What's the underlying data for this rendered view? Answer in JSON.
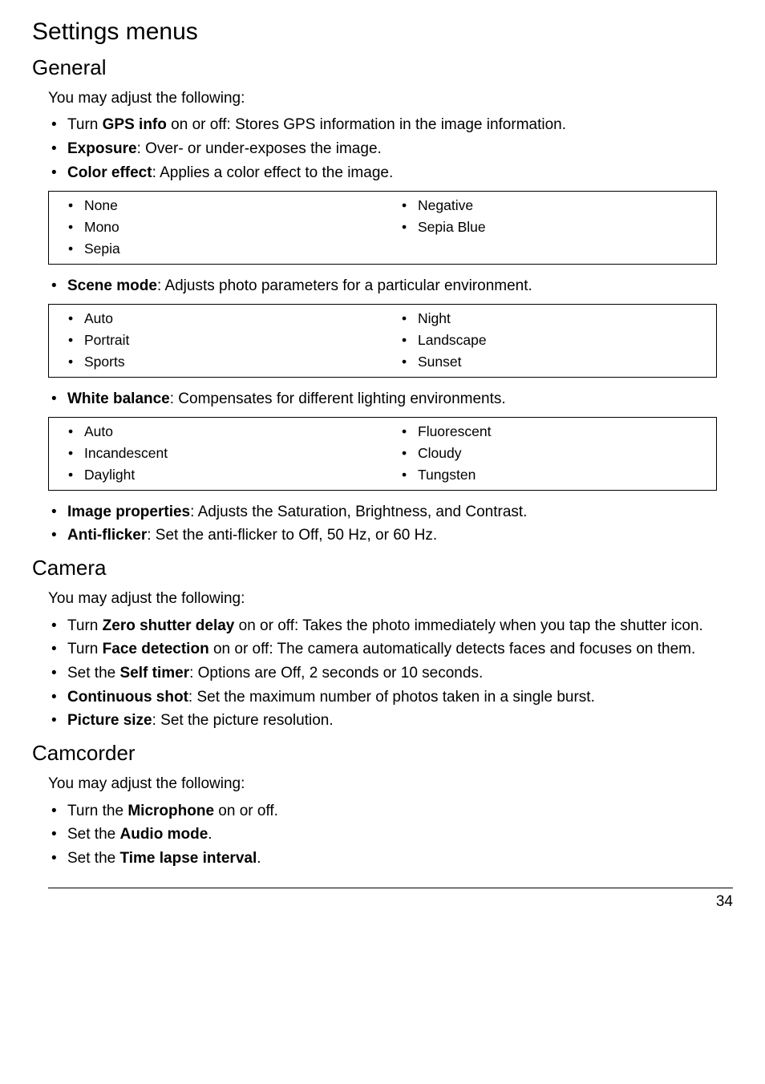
{
  "h1": "Settings menus",
  "general": {
    "heading": "General",
    "intro": "You may adjust the following:",
    "bullets": {
      "gps": {
        "pre": "Turn ",
        "bold": "GPS info",
        "post": " on or off: Stores GPS information in the image information."
      },
      "exposure": {
        "bold": "Exposure",
        "post": ": Over- or under-exposes the image."
      },
      "color_effect": {
        "bold": "Color effect",
        "post": ": Applies a color effect to the image."
      }
    },
    "color_effect_options": {
      "left": [
        "None",
        "Mono",
        "Sepia"
      ],
      "right": [
        "Negative",
        "Sepia Blue"
      ]
    },
    "scene_mode": {
      "bold": "Scene mode",
      "post": ": Adjusts photo parameters for a particular environment."
    },
    "scene_mode_options": {
      "left": [
        "Auto",
        "Portrait",
        "Sports"
      ],
      "right": [
        "Night",
        "Landscape",
        "Sunset"
      ]
    },
    "white_balance": {
      "bold": "White balance",
      "post": ": Compensates for different lighting environments."
    },
    "white_balance_options": {
      "left": [
        "Auto",
        "Incandescent",
        "Daylight"
      ],
      "right": [
        "Fluorescent",
        "Cloudy",
        "Tungsten"
      ]
    },
    "image_properties": {
      "bold": "Image properties",
      "post": ": Adjusts the Saturation, Brightness, and Contrast."
    },
    "anti_flicker": {
      "bold": "Anti-flicker",
      "post": ": Set the anti-flicker to Off, 50 Hz, or 60 Hz."
    }
  },
  "camera": {
    "heading": "Camera",
    "intro": "You may adjust the following:",
    "bullets": {
      "zero_shutter": {
        "pre": "Turn ",
        "bold": "Zero shutter delay",
        "post": " on or off: Takes the photo immediately when you tap the shutter icon."
      },
      "face_detection": {
        "pre": "Turn ",
        "bold": "Face detection",
        "post": " on or off: The camera automatically detects faces and focuses on them."
      },
      "self_timer": {
        "pre": "Set the ",
        "bold": "Self timer",
        "post": ": Options are Off, 2 seconds or 10 seconds."
      },
      "continuous_shot": {
        "bold": "Continuous shot",
        "post": ": Set the maximum number of photos taken in a single burst."
      },
      "picture_size": {
        "bold": "Picture size",
        "post": ": Set the picture resolution."
      }
    }
  },
  "camcorder": {
    "heading": "Camcorder",
    "intro": "You may adjust the following:",
    "bullets": {
      "microphone": {
        "pre": "Turn the ",
        "bold": "Microphone",
        "post": " on or off."
      },
      "audio_mode": {
        "pre": "Set the ",
        "bold": "Audio mode",
        "post": "."
      },
      "time_lapse": {
        "pre": "Set the ",
        "bold": "Time lapse interval",
        "post": "."
      }
    }
  },
  "page_number": "34"
}
